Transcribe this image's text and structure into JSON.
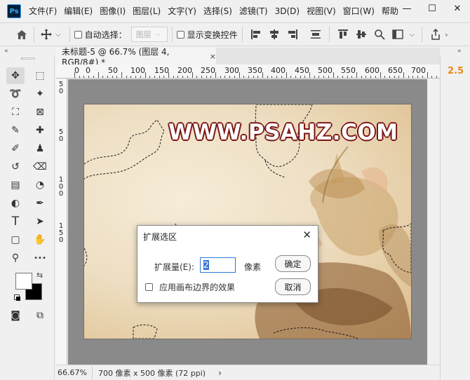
{
  "app": {
    "logo_text": "Ps"
  },
  "menu": [
    "文件(F)",
    "编辑(E)",
    "图像(I)",
    "图层(L)",
    "文字(Y)",
    "选择(S)",
    "滤镜(T)",
    "3D(D)",
    "视图(V)",
    "窗口(W)",
    "帮助"
  ],
  "window_controls": {
    "minimize": "—",
    "maximize": "☐",
    "close": "✕"
  },
  "options_bar": {
    "auto_select_label": "自动选择：",
    "layer_dropdown_value": "图层",
    "show_transform_label": "显示变换控件"
  },
  "collapse_glyph": "«",
  "document_tab": {
    "title": "未标题-5 @ 66.7% (图层 4, RGB/8#) *",
    "close": "×"
  },
  "ruler_top_labels": [
    "0",
    "0",
    "50",
    "100",
    "150",
    "200",
    "250",
    "300",
    "350",
    "400",
    "450",
    "500",
    "550",
    "600",
    "650",
    "700"
  ],
  "ruler_left_labels": [
    "5",
    "0",
    "5",
    "0",
    "1",
    "0",
    "0",
    "1",
    "5",
    "0"
  ],
  "canvas": {
    "watermark": "WWW.PSAHZ.COM"
  },
  "right_panel": {
    "value": "2.5"
  },
  "status_bar": {
    "zoom": "66.67%",
    "doc_info": "700 像素 x 500 像素 (72 ppi)",
    "arrow": "›"
  },
  "dialog": {
    "title": "扩展选区",
    "close": "✕",
    "expand_label": "扩展量(E):",
    "expand_value": "2",
    "unit": "像素",
    "canvas_edge_label": "应用画布边界的效果",
    "canvas_edge_checked": false,
    "ok_label": "确定",
    "cancel_label": "取消"
  },
  "tools": {
    "move": "✥",
    "marquee": "⬚",
    "lasso": "➰",
    "magic_wand": "✦",
    "crop": "⛶",
    "frame": "⊠",
    "eyedropper": "✎",
    "healing": "✚",
    "brush": "✐",
    "stamp": "♟",
    "history_brush": "↺",
    "eraser": "⌫",
    "gradient": "▤",
    "blur": "◔",
    "dodge": "◐",
    "pen": "✒",
    "type": "T",
    "path_select": "➤",
    "shape": "▢",
    "hand": "✋",
    "zoom": "⚲",
    "more": "•••",
    "swap": "⇆",
    "quick_mask": "◙",
    "screen_mode": "⧉"
  },
  "colors": {
    "foreground": "#ffffff",
    "background": "#000000",
    "accent": "#e88a1a",
    "watermark_outline": "#7a1414"
  }
}
